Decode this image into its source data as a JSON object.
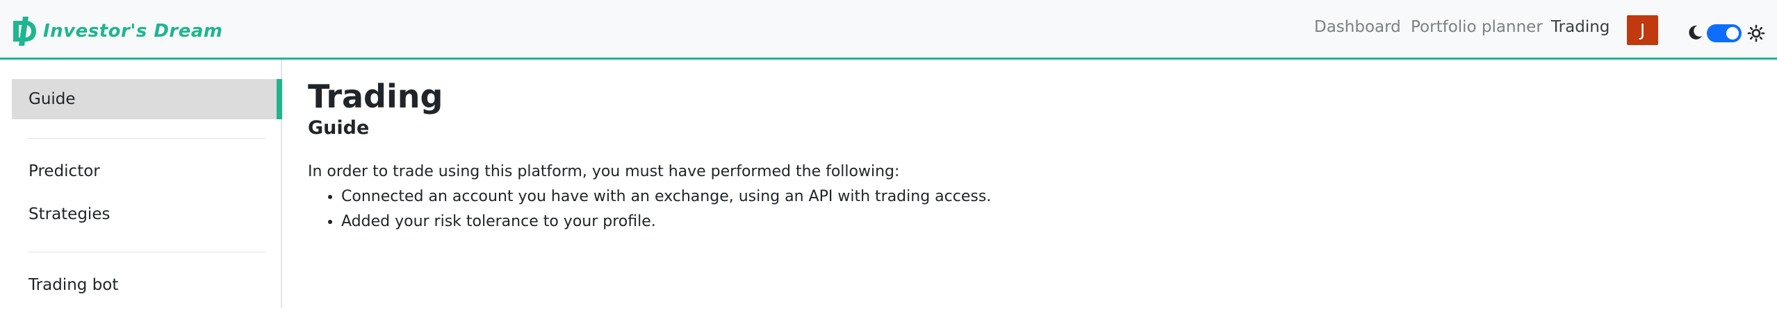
{
  "navbar": {
    "brand": "Investor's Dream",
    "links": [
      {
        "label": "Dashboard",
        "active": false
      },
      {
        "label": "Portfolio planner",
        "active": false
      },
      {
        "label": "Trading",
        "active": true
      }
    ],
    "avatar_initial": "J",
    "avatar_color": "#c0390f",
    "theme_toggle_on": true
  },
  "colors": {
    "accent": "#1fb58f",
    "toggle": "#0d6efd"
  },
  "icons": {
    "brand": "investors-dream-logo-icon",
    "dark_mode": "moon-icon",
    "light_mode": "sun-icon"
  },
  "sidebar": {
    "items": [
      {
        "label": "Guide",
        "active": true
      },
      {
        "label": "Predictor",
        "active": false
      },
      {
        "label": "Strategies",
        "active": false
      },
      {
        "label": "Trading bot",
        "active": false
      }
    ]
  },
  "main": {
    "title": "Trading",
    "subtitle": "Guide",
    "intro": "In order to trade using this platform, you must have performed the following:",
    "requirements": [
      "Connected an account you have with an exchange, using an API with trading access.",
      "Added your risk tolerance to your profile."
    ]
  }
}
